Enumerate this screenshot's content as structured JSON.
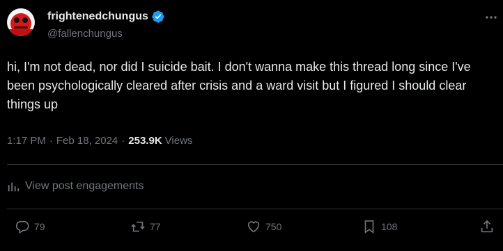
{
  "author": {
    "display_name": "frightenedchungus",
    "handle": "@fallenchungus",
    "verified": true,
    "verified_color": "#1d9bf0"
  },
  "tweet": {
    "text": "hi, I'm not dead, nor did I suicide bait. I don't wanna make this thread long since I've been psychologically cleared after crisis and a ward visit but I figured I should clear things up",
    "time": "1:17 PM",
    "date": "Feb 18, 2024",
    "views_count": "253.9K",
    "views_label": "Views"
  },
  "engagements_link": "View post engagements",
  "actions": {
    "replies": "79",
    "reposts": "77",
    "likes": "750",
    "bookmarks": "108"
  },
  "icons": [
    "more-icon",
    "verified-badge-icon",
    "analytics-icon",
    "reply-icon",
    "repost-icon",
    "like-icon",
    "bookmark-icon",
    "share-icon"
  ]
}
